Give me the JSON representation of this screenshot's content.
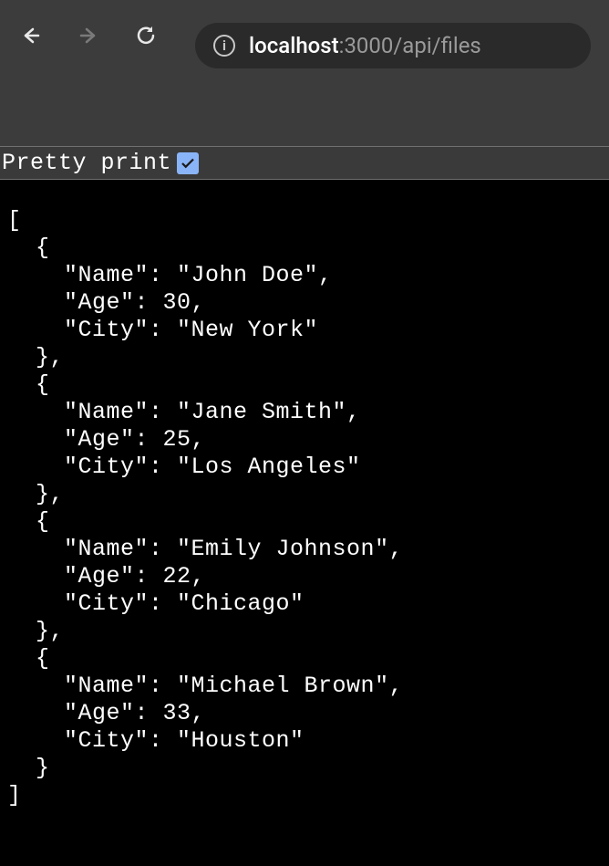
{
  "toolbar": {
    "url_host": "localhost",
    "url_path": ":3000/api/files"
  },
  "pretty_print": {
    "label": "Pretty print",
    "checked": true
  },
  "json_data": [
    {
      "Name": "John Doe",
      "Age": 30,
      "City": "New York"
    },
    {
      "Name": "Jane Smith",
      "Age": 25,
      "City": "Los Angeles"
    },
    {
      "Name": "Emily Johnson",
      "Age": 22,
      "City": "Chicago"
    },
    {
      "Name": "Michael Brown",
      "Age": 33,
      "City": "Houston"
    }
  ]
}
